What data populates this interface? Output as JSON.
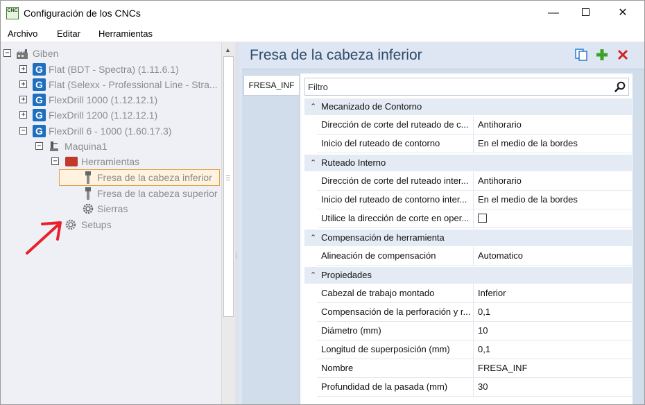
{
  "window": {
    "icon_text": "CNC",
    "title": "Configuración de los CNCs",
    "minimize": "—",
    "close": "✕"
  },
  "menu": [
    "Archivo",
    "Editar",
    "Herramientas"
  ],
  "tree": {
    "root": "Giben",
    "cnc_items": [
      "Flat (BDT - Spectra) (1.11.6.1)",
      "Flat (Selexx - Professional Line - Stra...",
      "FlexDrill 1000 (1.12.12.1)",
      "FlexDrill 1200 (1.12.12.1)",
      "FlexDrill 6 - 1000 (1.60.17.3)"
    ],
    "machine": "Maquina1",
    "tools_folder": "Herramientas",
    "tool_items": [
      "Fresa de la cabeza inferior",
      "Fresa de la cabeza superior",
      "Sierras"
    ],
    "setups": "Setups"
  },
  "panel": {
    "title": "Fresa de la cabeza inferior",
    "tab_label": "FRESA_INF",
    "filter_placeholder": "Filtro"
  },
  "properties": [
    {
      "category": "Mecanizado de Contorno",
      "rows": [
        {
          "name": "Dirección de corte del ruteado de c...",
          "value": "Antihorario"
        },
        {
          "name": "Inicio del ruteado de contorno",
          "value": "En el medio de la bordes"
        }
      ]
    },
    {
      "category": "Ruteado Interno",
      "rows": [
        {
          "name": "Dirección de corte del ruteado inter...",
          "value": "Antihorario"
        },
        {
          "name": "Inicio del ruteado de contorno inter...",
          "value": "En el medio de la bordes"
        },
        {
          "name": "Utilice la dirección de corte en oper...",
          "value": "",
          "checkbox": true,
          "checked": false
        }
      ]
    },
    {
      "category": "Compensación de herramienta",
      "rows": [
        {
          "name": "Alineación de compensación",
          "value": "Automatico"
        }
      ]
    },
    {
      "category": "Propiedades",
      "rows": [
        {
          "name": "Cabezal de trabajo montado",
          "value": "Inferior"
        },
        {
          "name": "Compensación de la perforación y r...",
          "value": "0,1"
        },
        {
          "name": "Diámetro (mm)",
          "value": "10"
        },
        {
          "name": "Longitud de superposición (mm)",
          "value": "0,1"
        },
        {
          "name": "Nombre",
          "value": "FRESA_INF"
        },
        {
          "name": "Profundidad de la pasada (mm)",
          "value": "30"
        }
      ]
    }
  ],
  "colors": {
    "selection_bg": "#fff2de",
    "selection_border": "#e3a24a",
    "annotation_arrow": "#e8202a",
    "node_icon_blue": "#1f6fc0"
  }
}
